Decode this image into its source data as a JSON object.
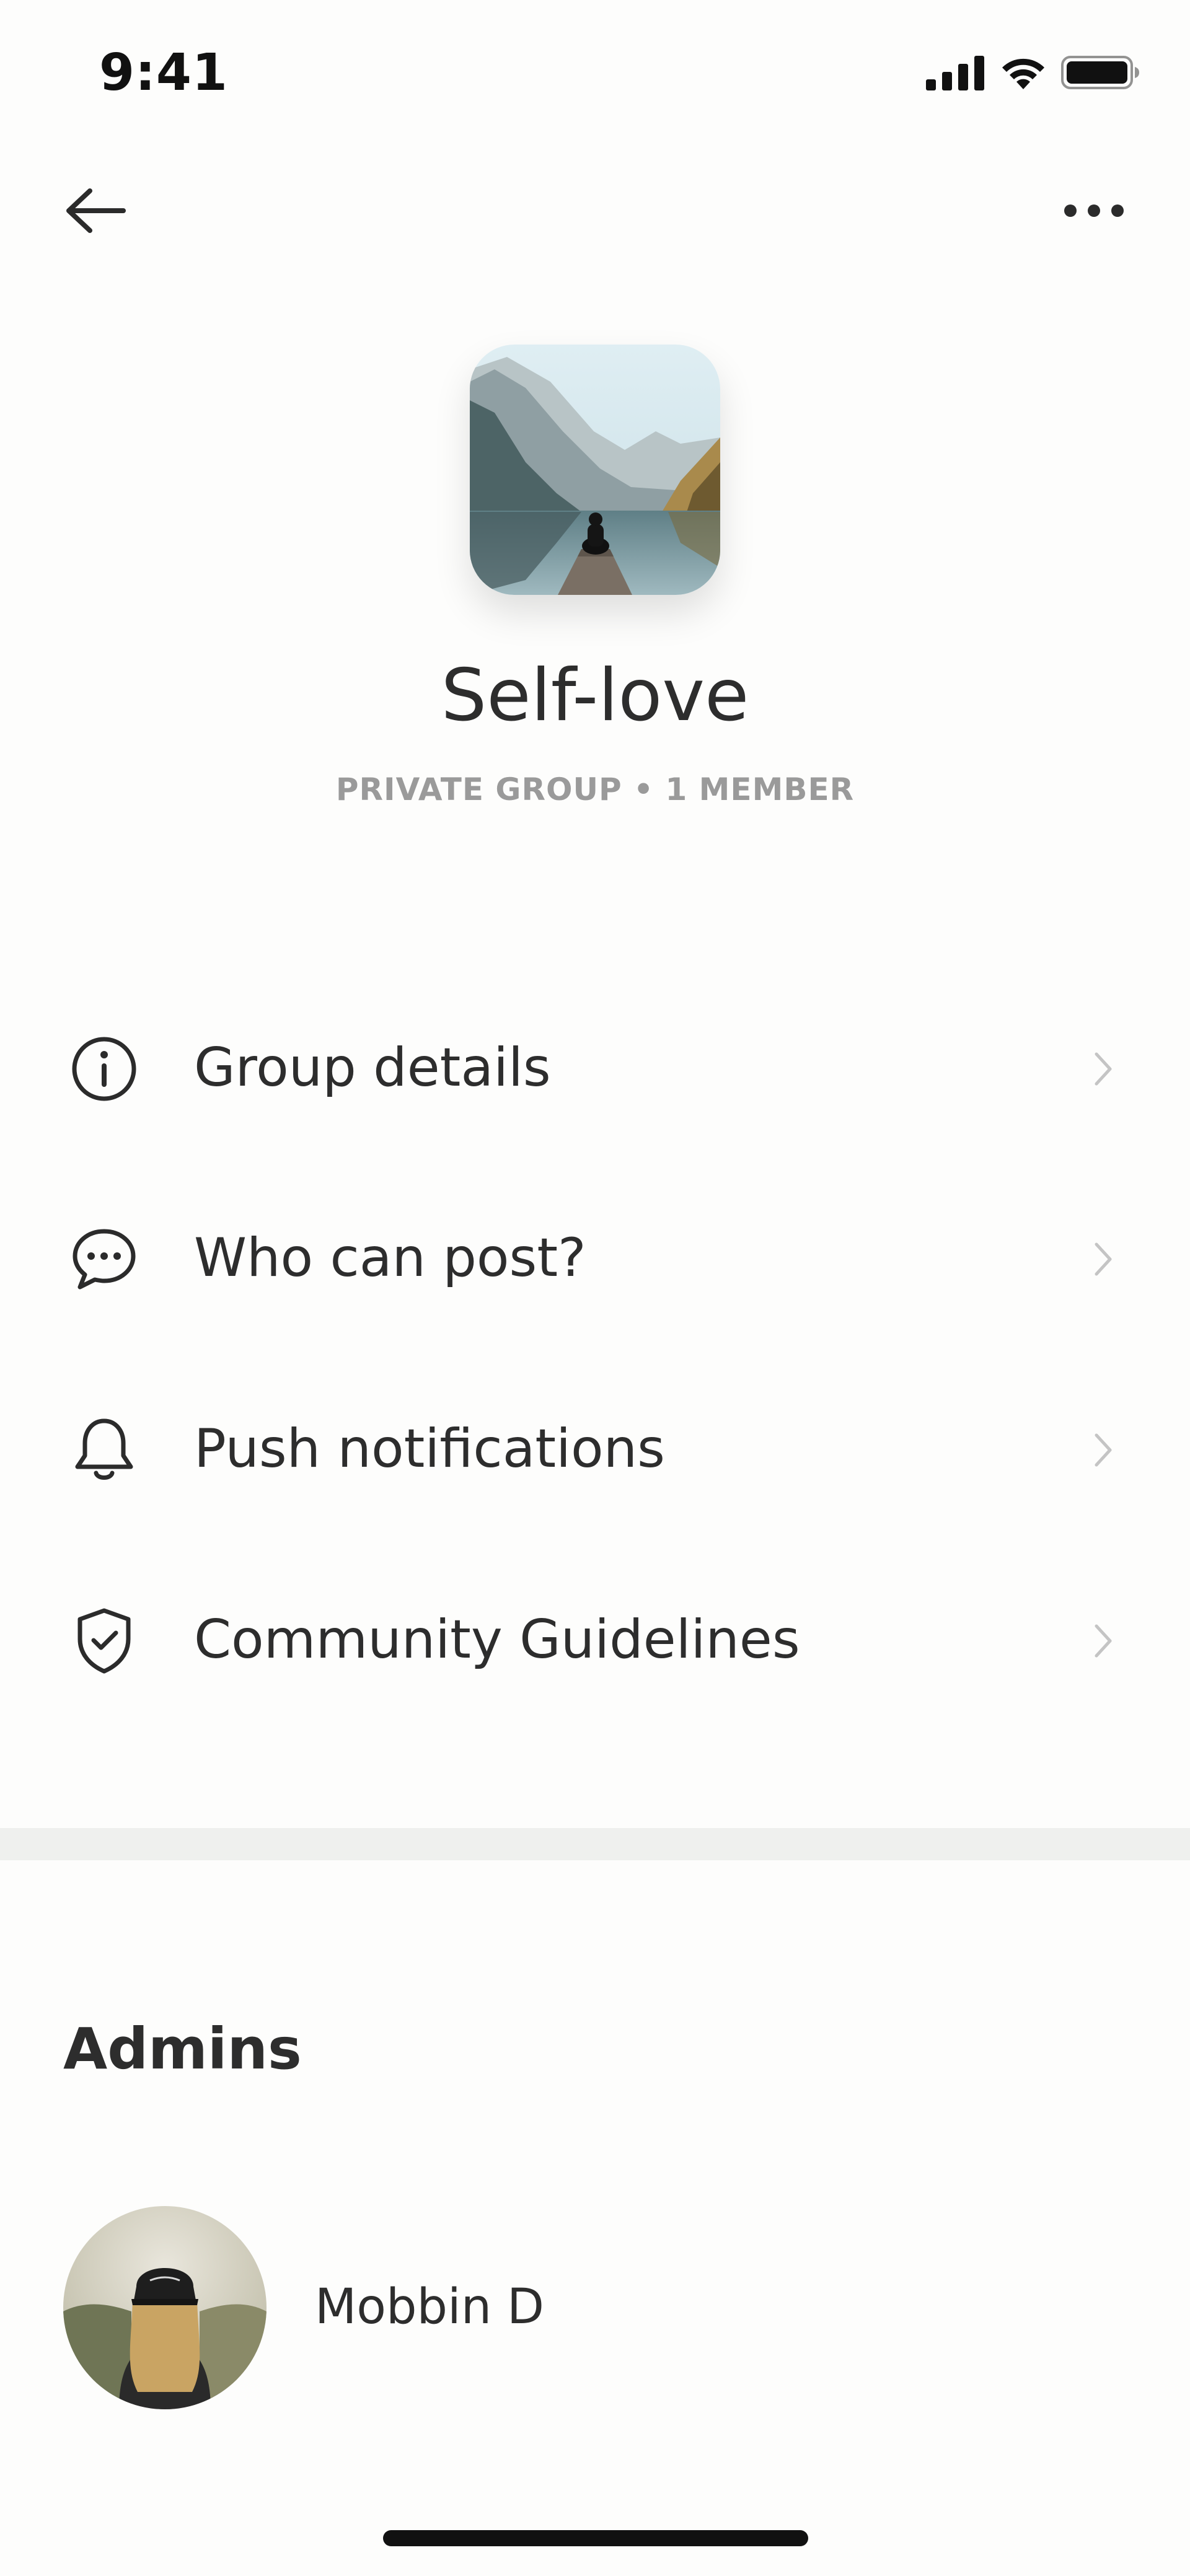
{
  "status_bar": {
    "time": "9:41"
  },
  "nav": {
    "back_icon": "arrow-left-icon",
    "more_icon": "more-horizontal-icon"
  },
  "group": {
    "title": "Self-love",
    "subtitle": "PRIVATE GROUP • 1 MEMBER"
  },
  "menu": {
    "items": [
      {
        "label": "Group details",
        "icon": "info-icon"
      },
      {
        "label": "Who can post?",
        "icon": "chat-bubble-icon"
      },
      {
        "label": "Push notifications",
        "icon": "bell-icon"
      },
      {
        "label": "Community Guidelines",
        "icon": "shield-check-icon"
      }
    ]
  },
  "admins": {
    "heading": "Admins",
    "list": [
      {
        "name": "Mobbin D"
      }
    ]
  }
}
